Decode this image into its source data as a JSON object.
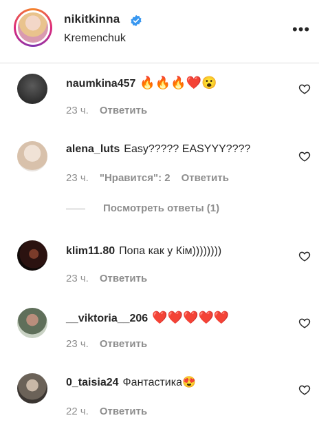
{
  "header": {
    "username": "nikitkinna",
    "location": "Kremenchuk",
    "more": "•••"
  },
  "comments": [
    {
      "user": "naumkina457",
      "text": "🔥🔥🔥❤️😮",
      "time": "23 ч.",
      "likes": "",
      "reply": "Ответить"
    },
    {
      "user": "alena_luts",
      "text": "Easy????? EASYYY????",
      "time": "23 ч.",
      "likes": "\"Нравится\": 2",
      "reply": "Ответить"
    },
    {
      "user": "klim11.80",
      "text": "Попа как у Кім))))))))",
      "time": "23 ч.",
      "likes": "",
      "reply": "Ответить"
    },
    {
      "user": "__viktoria__206",
      "text": "❤️❤️❤️❤️❤️",
      "time": "23 ч.",
      "likes": "",
      "reply": "Ответить"
    },
    {
      "user": "0_taisia24",
      "text": "Фантастика😍",
      "time": "22 ч.",
      "likes": "",
      "reply": "Ответить"
    }
  ],
  "view_replies": "Посмотреть ответы (1)",
  "icons": [
    "verified-badge-icon",
    "more-options-icon",
    "heart-outline-icon"
  ],
  "colors": {
    "verified": "#3897f0",
    "muted": "#8e8e8e",
    "text": "#262626"
  }
}
